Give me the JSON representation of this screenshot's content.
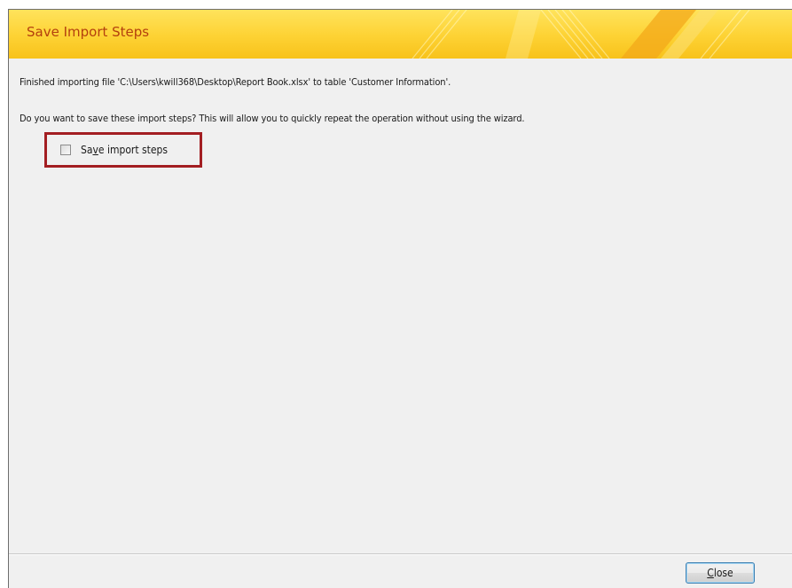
{
  "dialog": {
    "title": "Save Import Steps",
    "message_finished": "Finished importing file 'C:\\Users\\kwill368\\Desktop\\Report Book.xlsx' to table 'Customer Information'.",
    "message_question": "Do you want to save these import steps? This will allow you to quickly repeat the operation without using the wizard.",
    "save_steps_checkbox": {
      "label_before": "Sa",
      "label_mnemonic": "v",
      "label_after": "e import steps",
      "checked": false
    },
    "close_button": {
      "mnemonic": "C",
      "label_rest": "lose"
    }
  },
  "colors": {
    "header_gradient_top": "#ffe35c",
    "header_gradient_bottom": "#f8c21b",
    "title_color": "#b4400e",
    "highlight_border": "#a31e22",
    "dialog_background": "#f0f0f0"
  }
}
